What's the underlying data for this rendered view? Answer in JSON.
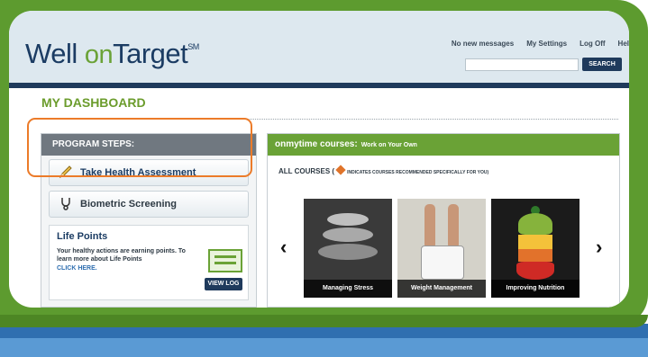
{
  "header": {
    "logo_prefix": "Well ",
    "logo_on": "on",
    "logo_suffix": "Target",
    "logo_mark": "SM",
    "links": [
      "No new messages",
      "My Settings",
      "Log Off",
      "Hel"
    ],
    "search_placeholder": "",
    "search_button": "SEARCH"
  },
  "dashboard": {
    "title": "MY DASHBOARD"
  },
  "program_steps": {
    "header": "PROGRAM STEPS:",
    "items": [
      {
        "label": "Take Health Assessment",
        "icon": "pencil-icon"
      },
      {
        "label": "Biometric Screening",
        "icon": "stethoscope-icon"
      }
    ],
    "life_points": {
      "title": "Life Points",
      "text": "Your healthy actions are earning points. To learn more about Life Points",
      "link": "CLICK HERE.",
      "button": "VIEW LOG"
    }
  },
  "courses": {
    "header_bold": "onmytime courses:",
    "header_sub": "Work on Your Own",
    "all_courses": "ALL COURSES (",
    "recommended_note": "INDICATES COURSES RECOMMENDED SPECIFICALLY FOR YOU)",
    "tiles": [
      "Managing Stress",
      "Weight Management",
      "Improving Nutrition"
    ],
    "prev_arrow": "‹",
    "next_arrow": "›"
  },
  "colors": {
    "frame_green": "#5d9b2f",
    "frame_blue": "#2f6fb0",
    "highlight_orange": "#ec7b29",
    "navy": "#1f3a5c"
  }
}
